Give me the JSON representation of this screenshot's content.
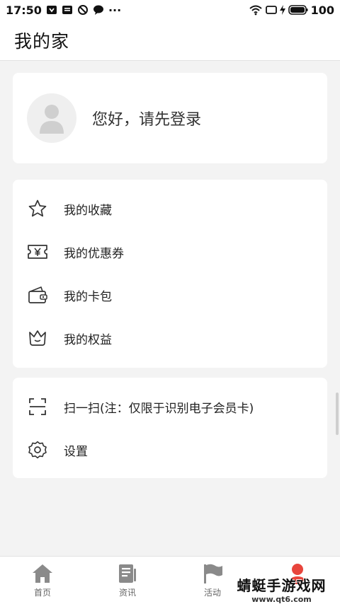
{
  "status_bar": {
    "time": "17:50",
    "dots": "···",
    "battery": "100"
  },
  "header": {
    "title": "我的家"
  },
  "profile": {
    "login_prompt": "您好，请先登录"
  },
  "menu_group_1": [
    {
      "label": "我的收藏",
      "icon": "star-icon"
    },
    {
      "label": "我的优惠券",
      "icon": "coupon-icon"
    },
    {
      "label": "我的卡包",
      "icon": "wallet-icon"
    },
    {
      "label": "我的权益",
      "icon": "crown-icon"
    }
  ],
  "menu_group_2": [
    {
      "label": "扫一扫(注：仅限于识别电子会员卡)",
      "icon": "scan-icon"
    },
    {
      "label": "设置",
      "icon": "gear-icon"
    }
  ],
  "tabbar": [
    {
      "label": "首页",
      "icon": "home-icon"
    },
    {
      "label": "资讯",
      "icon": "news-icon"
    },
    {
      "label": "活动",
      "icon": "flag-icon"
    },
    {
      "label": "",
      "icon": "profile-icon",
      "active": true
    }
  ],
  "watermark": {
    "main": "蜻蜓手游戏网",
    "sub": "www.qt6.com"
  },
  "colors": {
    "active_tab": "#e8453c",
    "inactive_tab": "#8a8a8a"
  }
}
